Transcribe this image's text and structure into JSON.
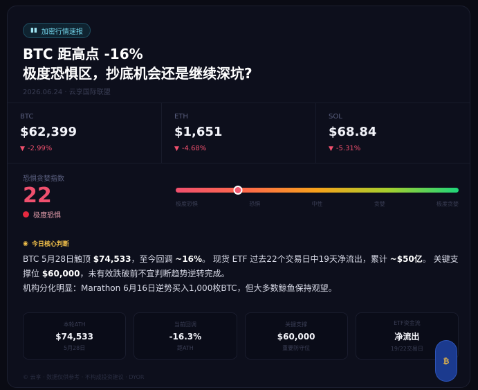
{
  "header": {
    "tag": "加密行情速报",
    "title_line1": "BTC 距高点 -16%",
    "title_line2": "极度恐惧区，抄底机会还是继续深坑?",
    "meta": "2026.06.24 · 云享国际联盟"
  },
  "prices": [
    {
      "coin": "BTC",
      "price": "$62,399",
      "change": "-2.99%"
    },
    {
      "coin": "ETH",
      "price": "$1,651",
      "change": "-4.68%"
    },
    {
      "coin": "SOL",
      "price": "$68.84",
      "change": "-5.31%"
    }
  ],
  "fear": {
    "label": "恐惧贪婪指数",
    "value": "22",
    "value_num": 22,
    "status": "极度恐惧",
    "gauge_labels": [
      "极度恐惧",
      "恐惧",
      "中性",
      "贪婪",
      "极度贪婪"
    ]
  },
  "judge": {
    "title": "今日核心判断",
    "p1_a": "BTC 5月28日触顶 ",
    "p1_b": "$74,533",
    "p1_c": "，至今回调 ",
    "p1_d": "~16%",
    "p1_e": "。 现货 ETF 过去22个交易日中19天净流出，累计 ",
    "p1_f": "~$50亿",
    "p1_g": "。 关键支撑位 ",
    "p1_h": "$60,000",
    "p1_i": "，未有效跌破前不宜判断趋势逆转完成。",
    "p2": "机构分化明显：Marathon 6月16日逆势买入1,000枚BTC，但大多数鲸鱼保持观望。"
  },
  "stats": [
    {
      "label": "本轮ATH",
      "value": "$74,533",
      "sub": "5月28日"
    },
    {
      "label": "当前回调",
      "value": "-16.3%",
      "sub": "距ATH"
    },
    {
      "label": "关键支撑",
      "value": "$60,000",
      "sub": "重要防守位"
    },
    {
      "label": "ETF资金流",
      "value": "净流出",
      "sub": "19/22交易日"
    }
  ],
  "footer": "© 云享 · 数据仅供参考 · 不构成投资建议 · DYOR",
  "colors": {
    "accent_red": "#f0506e",
    "accent_yellow": "#f2c04a",
    "tag_cyan": "#6fd0e6"
  }
}
